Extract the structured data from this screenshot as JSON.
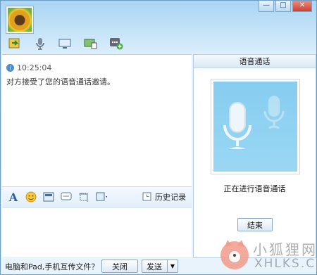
{
  "window": {
    "minimize": "—",
    "maximize": "□",
    "close": "✕"
  },
  "toolbar": {
    "icons": [
      "transfer-file-icon",
      "voice-mic-icon",
      "video-screen-icon",
      "remote-desktop-icon",
      "add-app-icon"
    ]
  },
  "chat": {
    "time": "10:25:04",
    "message": "对方接受了您的语音通话邀请。"
  },
  "format_bar": {
    "font_glyph": "A",
    "history_label": "历史记录"
  },
  "bottom": {
    "promo": "电脑和Pad,手机互传文件？",
    "close_label": "关闭",
    "send_label": "发送",
    "send_arrow": "▼"
  },
  "voice_panel": {
    "title": "语音通话",
    "status": "正在进行语音通话",
    "end_label": "结束"
  },
  "watermark": {
    "cn": "小狐狸网",
    "en": "XHLKS.CN"
  },
  "colors": {
    "accent": "#4a8fd6",
    "panel_blue": "#8fd2f2"
  }
}
